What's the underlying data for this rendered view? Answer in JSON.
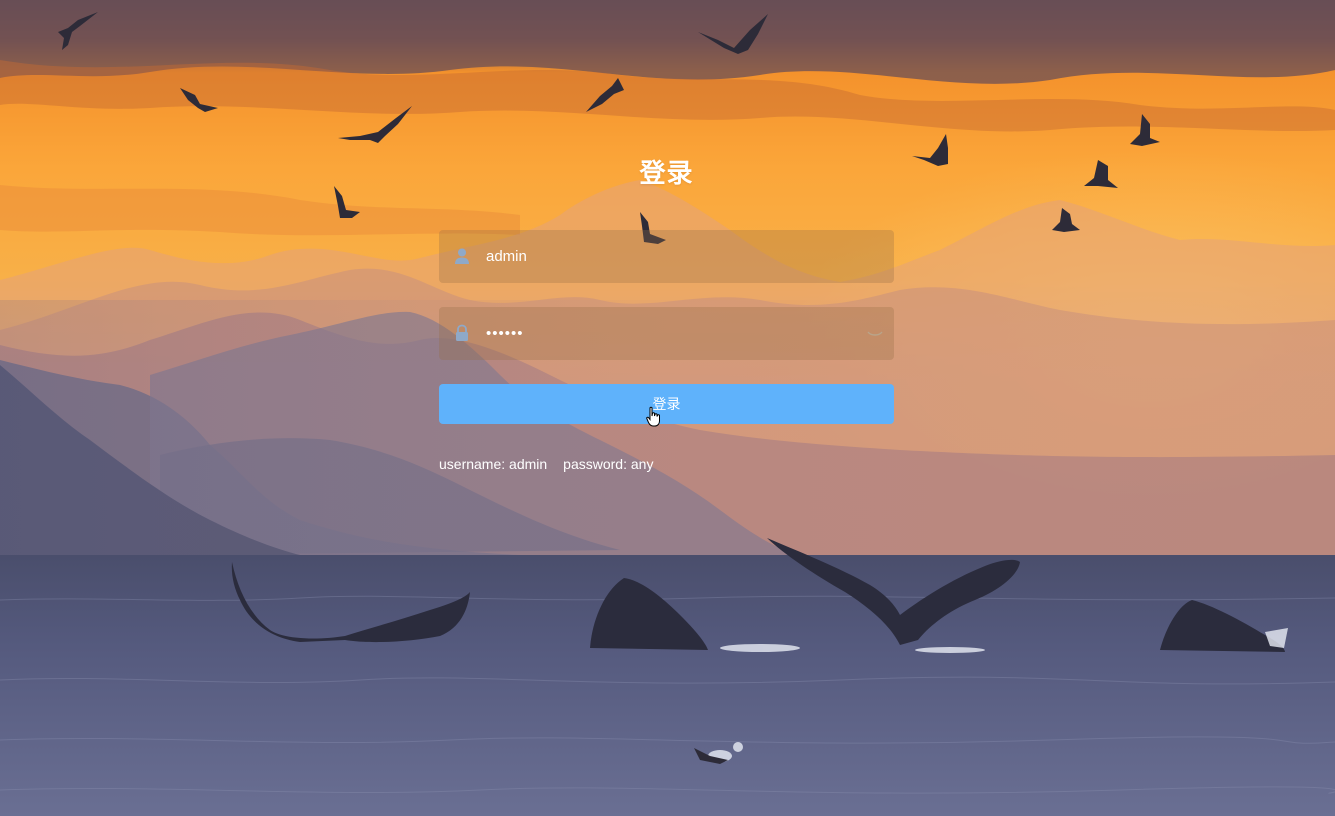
{
  "login": {
    "title": "登录",
    "username_value": "admin",
    "password_value": "••••••",
    "button_label": "登录",
    "tip_username": "username: admin",
    "tip_password": "password: any"
  },
  "icons": {
    "user": "user-icon",
    "lock": "lock-icon",
    "eye": "eye-closed-icon",
    "cursor": "hand-pointer-cursor"
  },
  "colors": {
    "button": "#5fb2fb",
    "text": "#ffffff",
    "field_bg": "rgba(150,110,70,0.30)"
  }
}
